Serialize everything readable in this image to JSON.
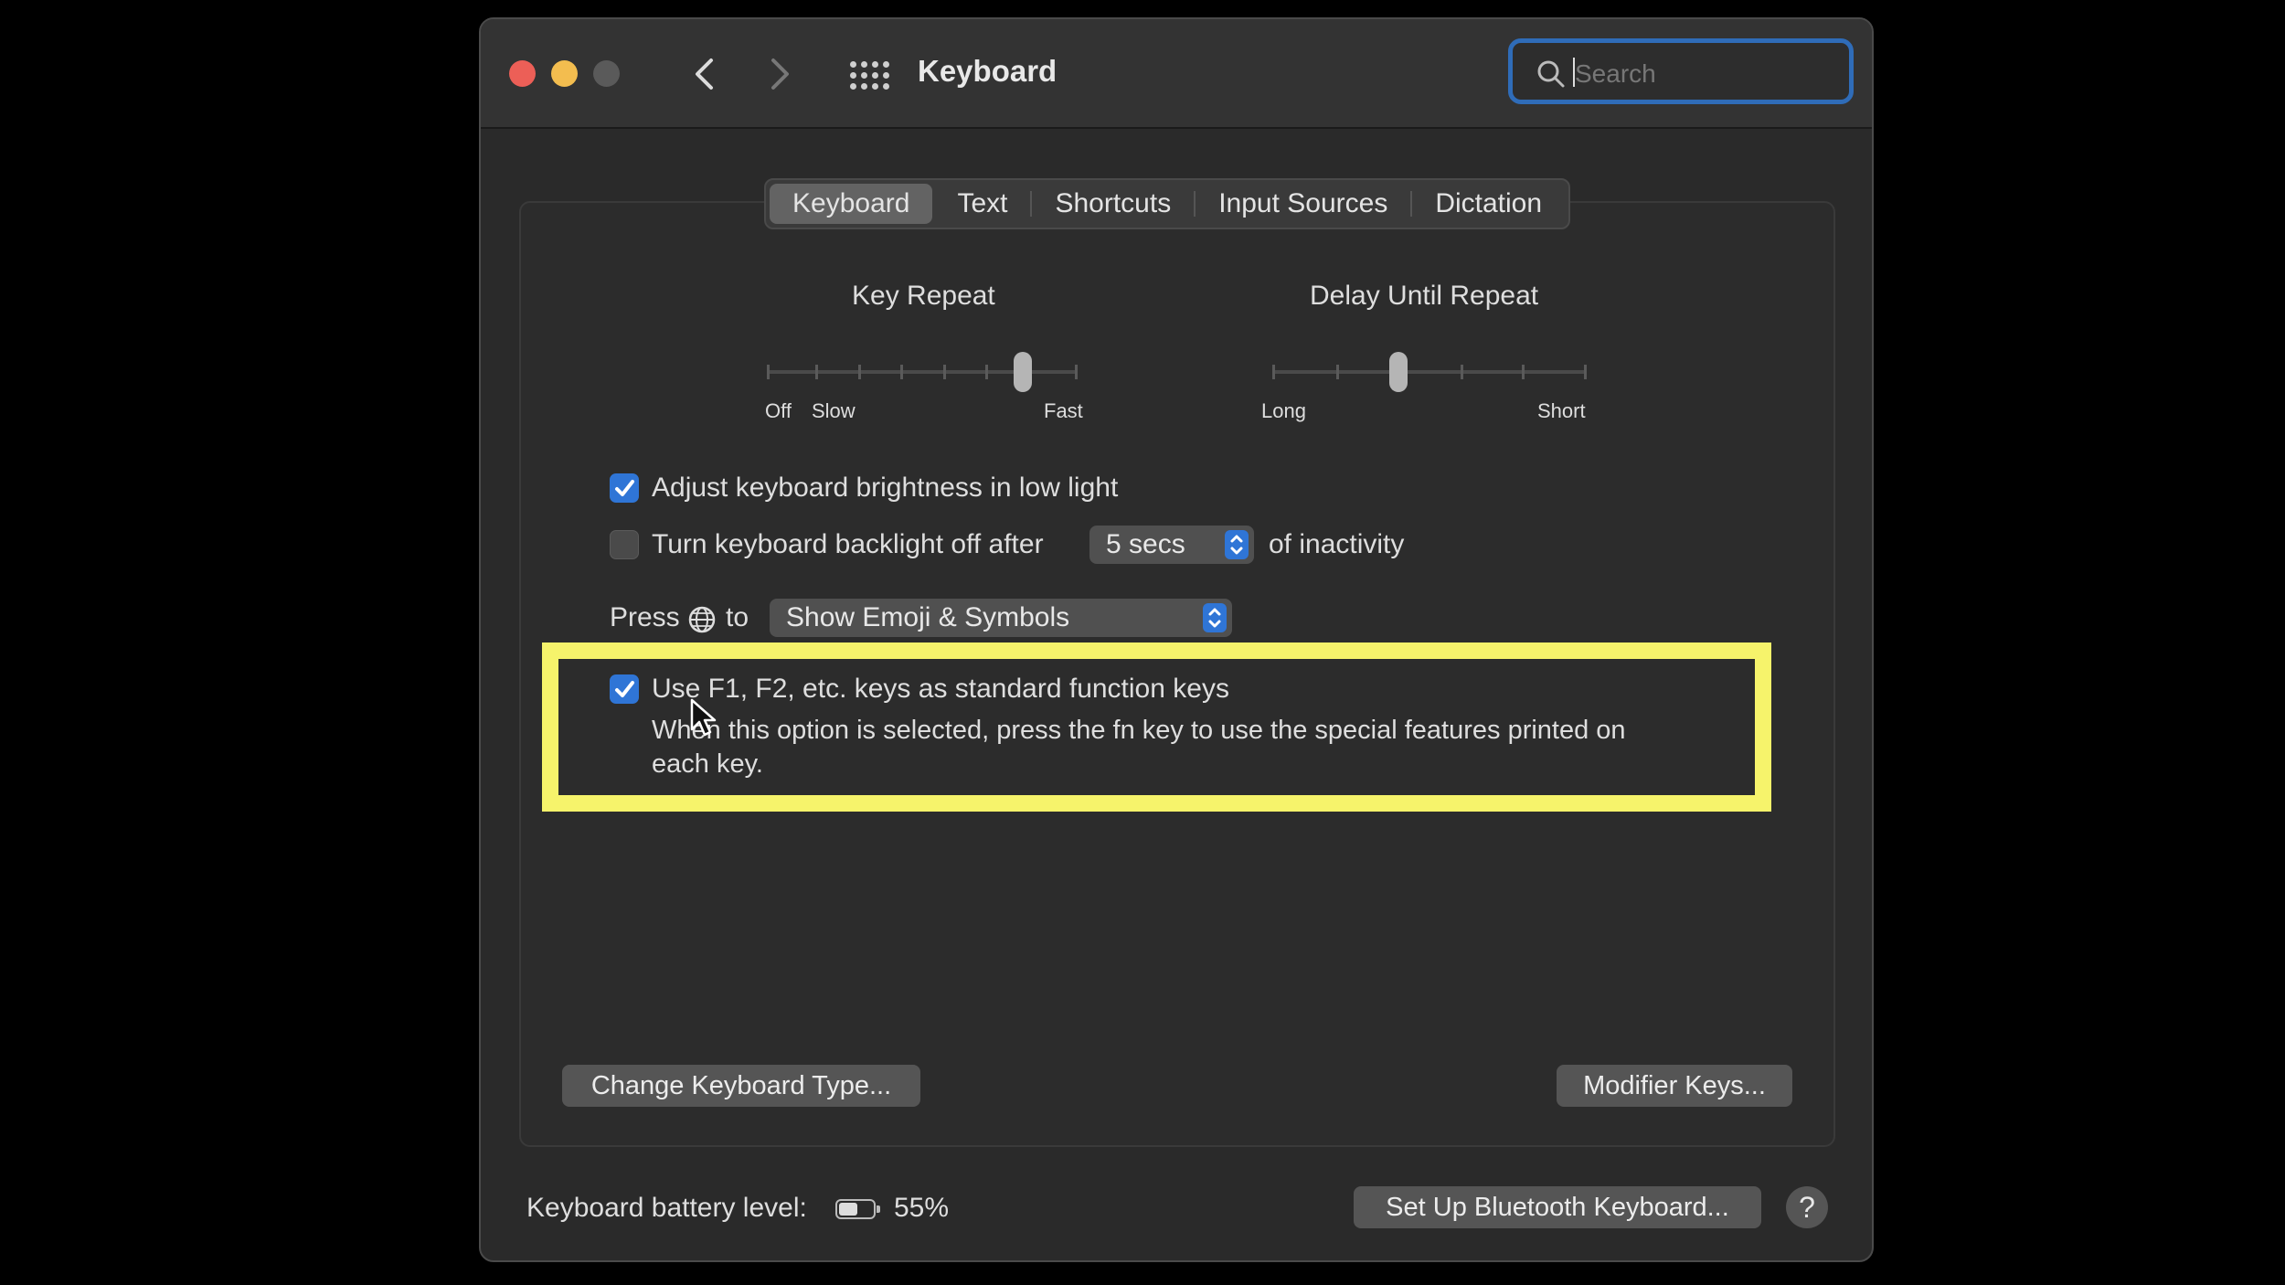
{
  "window": {
    "title": "Keyboard",
    "search_placeholder": "Search",
    "back_icon": "chevron-left",
    "forward_icon": "chevron-right",
    "show_all_icon": "grid"
  },
  "tabs": [
    {
      "label": "Keyboard",
      "active": true
    },
    {
      "label": "Text"
    },
    {
      "label": "Shortcuts"
    },
    {
      "label": "Input Sources"
    },
    {
      "label": "Dictation"
    }
  ],
  "key_repeat": {
    "label": "Key Repeat",
    "min_label_off": "Off",
    "min_label_slow": "Slow",
    "max_label": "Fast",
    "level_fraction": 0.85
  },
  "delay_until_repeat": {
    "label": "Delay Until Repeat",
    "min_label": "Long",
    "max_label": "Short",
    "level_fraction": 0.4
  },
  "options": {
    "adjust_brightness": {
      "label": "Adjust keyboard brightness in low light",
      "checked": true
    },
    "backlight_off": {
      "label": "Turn keyboard backlight off after",
      "checked": false,
      "value": "5 secs",
      "suffix": "of inactivity"
    },
    "press_globe": {
      "prefix": "Press",
      "suffix": "to",
      "value": "Show Emoji & Symbols"
    },
    "function_keys": {
      "label": "Use F1, F2, etc. keys as standard function keys",
      "checked": true,
      "description_line1": "When this option is selected, press the fn key to use the special features printed on",
      "description_line2": "each key."
    }
  },
  "buttons": {
    "change_keyboard_type": "Change Keyboard Type...",
    "modifier_keys": "Modifier Keys...",
    "bluetooth": "Set Up Bluetooth Keyboard...",
    "help": "?"
  },
  "battery": {
    "label": "Keyboard battery level:",
    "percent_text": "55%",
    "level": 0.55
  },
  "colors": {
    "highlight": "#f6f36b",
    "accent": "#2f75d6",
    "close": "#ec5f57",
    "minimize": "#f3bd4f"
  }
}
